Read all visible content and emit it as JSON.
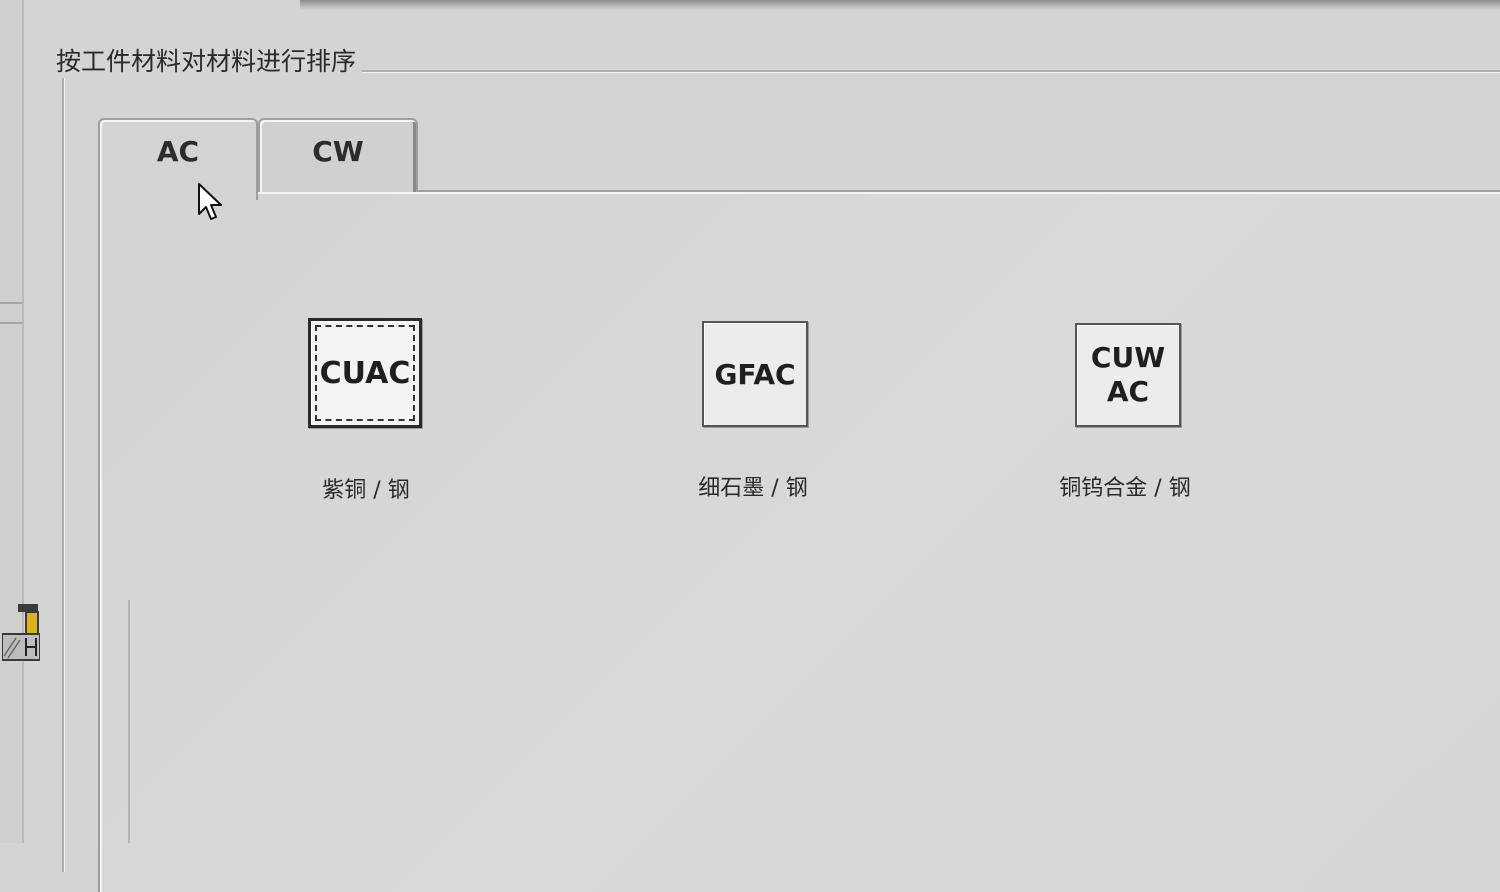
{
  "groupbox": {
    "title": "按工件材料对材料进行排序"
  },
  "tabs": [
    {
      "label": "AC",
      "active": true
    },
    {
      "label": "CW",
      "active": false
    }
  ],
  "materials": [
    {
      "code": "CUAC",
      "code_lines": [
        "CUAC"
      ],
      "caption": "紫铜 / 钢",
      "selected": true
    },
    {
      "code": "GFAC",
      "code_lines": [
        "GFAC"
      ],
      "caption": "细石墨 / 钢",
      "selected": false
    },
    {
      "code": "CUW AC",
      "code_lines": [
        "CUW",
        "AC"
      ],
      "caption": "铜钨合金 / 钢",
      "selected": false
    }
  ],
  "icons": {
    "cursor": "mouse-pointer-icon",
    "side": "tool-holder-icon"
  }
}
